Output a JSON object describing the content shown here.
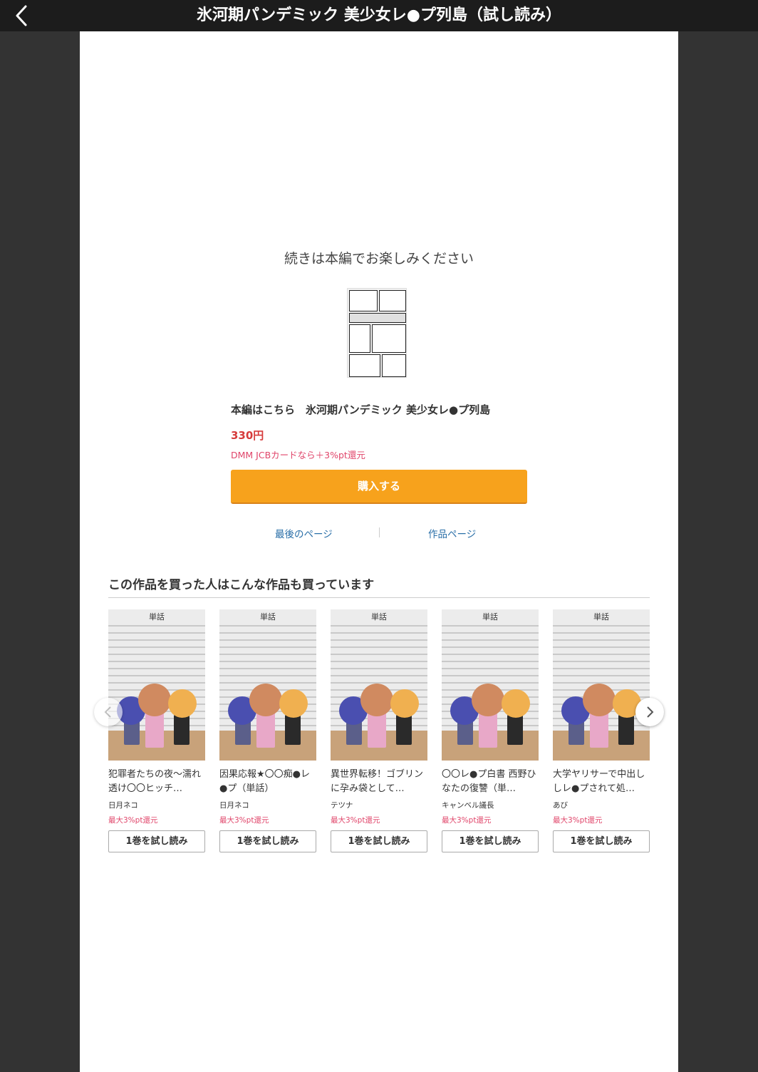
{
  "header": {
    "title": "氷河期パンデミック 美少女レ●プ列島（試し読み）"
  },
  "main": {
    "continue_text": "続きは本編でお楽しみください",
    "product_title": "本編はこちら　氷河期パンデミック 美少女レ●プ列島",
    "price": "330円",
    "jcb_note": "DMM JCBカードなら＋3%pt還元",
    "buy_label": "購入する",
    "last_page_link": "最後のページ",
    "work_page_link": "作品ページ"
  },
  "recommend": {
    "heading": "この作品を買った人はこんな作品も買っています",
    "items": [
      {
        "badge": "単話",
        "title": "犯罪者たちの夜〜濡れ透け〇〇ヒッチ…",
        "author": "日月ネコ",
        "pt": "最大3%pt還元",
        "trial": "1巻を試し読み"
      },
      {
        "badge": "単話",
        "title": "因果応報★〇〇痴●レ●プ（単話）",
        "author": "日月ネコ",
        "pt": "最大3%pt還元",
        "trial": "1巻を試し読み"
      },
      {
        "badge": "単話",
        "title": "異世界転移！ゴブリンに孕み袋として…",
        "author": "テツナ",
        "pt": "最大3%pt還元",
        "trial": "1巻を試し読み"
      },
      {
        "badge": "単話",
        "title": "〇〇レ●プ白書 西野ひなたの復讐（単…",
        "author": "キャンベル議長",
        "pt": "最大3%pt還元",
        "trial": "1巻を試し読み"
      },
      {
        "badge": "単話",
        "title": "大学ヤリサーで中出ししレ●プされて処…",
        "author": "あび",
        "pt": "最大3%pt還元",
        "trial": "1巻を試し読み"
      }
    ]
  },
  "colors": {
    "accent": "#f7a21c",
    "price": "#d63b3b",
    "pt": "#e0456a",
    "link": "#2a6fa8"
  }
}
